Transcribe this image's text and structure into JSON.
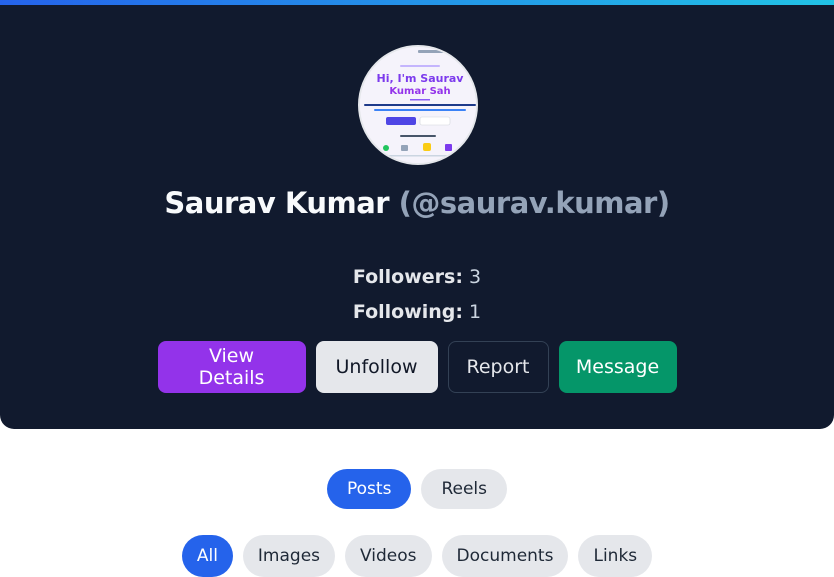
{
  "profile": {
    "display_name": "Saurav Kumar",
    "username": "(@saurav.kumar)",
    "avatar_preview": {
      "heading": "Hi, I'm Saurav Kumar Sah"
    },
    "stats": {
      "followers_label": "Followers:",
      "followers_value": "3",
      "following_label": "Following:",
      "following_value": "1"
    },
    "actions": {
      "view_details": "View Details",
      "unfollow": "Unfollow",
      "report": "Report",
      "message": "Message"
    }
  },
  "content_tabs": {
    "posts": "Posts",
    "reels": "Reels",
    "active": "Posts"
  },
  "filters": {
    "all": "All",
    "images": "Images",
    "videos": "Videos",
    "documents": "Documents",
    "links": "Links",
    "active": "All"
  },
  "colors": {
    "card_bg": "#111a2e",
    "primary": "#2563eb",
    "view_details": "#9333ea",
    "message": "#059669"
  }
}
